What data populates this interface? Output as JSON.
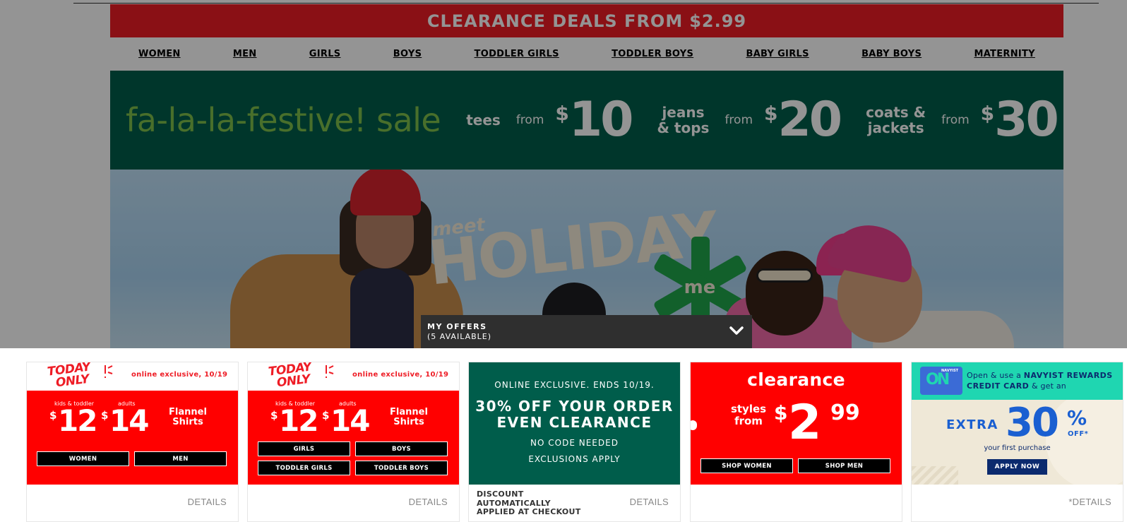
{
  "clearance_banner": {
    "text": "CLEARANCE DEALS FROM",
    "price": "$2.99",
    "bg_color": "#ee1c25"
  },
  "category_nav": [
    {
      "label": "WOMEN"
    },
    {
      "label": "MEN"
    },
    {
      "label": "GIRLS"
    },
    {
      "label": "BOYS"
    },
    {
      "label": "TODDLER GIRLS"
    },
    {
      "label": "TODDLER BOYS"
    },
    {
      "label": "BABY GIRLS"
    },
    {
      "label": "BABY BOYS"
    },
    {
      "label": "MATERNITY"
    }
  ],
  "sale_banner": {
    "title": "fa-la-la-festive! sale",
    "groups": [
      {
        "line1": "tees",
        "line2": "",
        "from": "from",
        "currency": "$",
        "amount": "10"
      },
      {
        "line1": "jeans",
        "line2": "& tops",
        "from": "from",
        "currency": "$",
        "amount": "20"
      },
      {
        "line1": "coats &",
        "line2": "jackets",
        "from": "from",
        "currency": "$",
        "amount": "30"
      }
    ],
    "bg_color": "#005d4b",
    "title_color": "#7fc04a"
  },
  "hero": {
    "meet": "meet",
    "word": "HOLIDAY",
    "me": "me"
  },
  "offers_tab": {
    "title": "MY OFFERS",
    "subtitle": "(5 AVAILABLE)",
    "icon": "chevron-down-icon"
  },
  "offers": [
    {
      "today": "TODAY",
      "only": "ONLY",
      "exclusive": "online exclusive, 10/19",
      "kids_label": "kids & toddler",
      "adults_label": "adults",
      "kids_currency": "$",
      "kids_price": "12",
      "adults_currency": "$",
      "adults_price": "14",
      "product_line1": "Flannel",
      "product_line2": "Shirts",
      "buttons": [
        "WOMEN",
        "MEN"
      ],
      "details": "DETAILS"
    },
    {
      "today": "TODAY",
      "only": "ONLY",
      "exclusive": "online exclusive, 10/19",
      "kids_label": "kids & toddler",
      "adults_label": "adults",
      "kids_currency": "$",
      "kids_price": "12",
      "adults_currency": "$",
      "adults_price": "14",
      "product_line1": "Flannel",
      "product_line2": "Shirts",
      "buttons": [
        "GIRLS",
        "BOYS",
        "TODDLER GIRLS",
        "TODDLER BOYS"
      ],
      "details": "DETAILS"
    },
    {
      "line1": "ONLINE EXCLUSIVE. ENDS 10/19.",
      "headline1": "30% OFF YOUR ORDER",
      "headline2": "EVEN CLEARANCE",
      "line3": "NO CODE NEEDED",
      "line4": "EXCLUSIONS APPLY",
      "note_line1": "DISCOUNT",
      "note_line2": "AUTOMATICALLY",
      "note_line3": "APPLIED AT CHECKOUT",
      "details": "DETAILS"
    },
    {
      "title": "clearance",
      "styles_line1": "styles",
      "styles_line2": "from",
      "currency": "$",
      "dollars": "2",
      "cents": "99",
      "buttons": [
        "SHOP WOMEN",
        "SHOP MEN"
      ]
    },
    {
      "card_text": "NAVYIST",
      "card_logo": "ON",
      "text_pre": "Open & use a",
      "text_bold": "NAVYIST REWARDS CREDIT CARD",
      "text_post": "& get an",
      "extra": "EXTRA",
      "percent_value": "30",
      "percent_sign": "%",
      "off": "OFF*",
      "first_purchase": "your first purchase",
      "apply": "APPLY NOW",
      "details": "*DETAILS"
    }
  ]
}
